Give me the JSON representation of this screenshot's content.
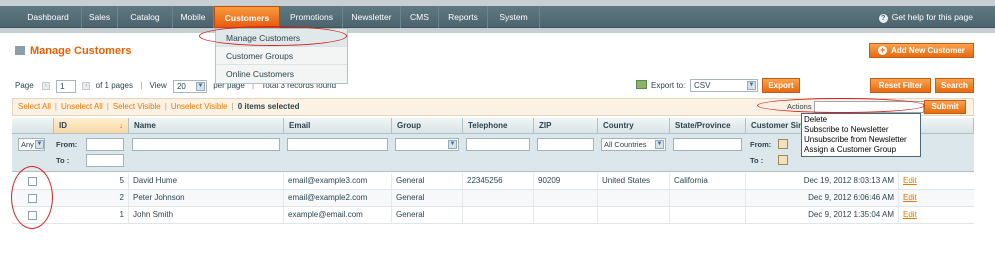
{
  "nav": {
    "items": [
      "Dashboard",
      "Sales",
      "Catalog",
      "Mobile",
      "Customers",
      "Promotions",
      "Newsletter",
      "CMS",
      "Reports",
      "System"
    ],
    "active": "Customers",
    "help": "Get help for this page"
  },
  "dropdown": [
    "Manage Customers",
    "Customer Groups",
    "Online Customers"
  ],
  "page": {
    "title": "Manage Customers",
    "add_button": "Add New Customer"
  },
  "pager": {
    "page_label": "Page",
    "page_value": "1",
    "of_pages": "of 1 pages",
    "view_label": "View",
    "per_page_value": "20",
    "per_page": "per page",
    "records": "Total 3 records found"
  },
  "export": {
    "label": "Export to:",
    "format": "CSV",
    "button": "Export"
  },
  "grid_buttons": {
    "reset": "Reset Filter",
    "search": "Search"
  },
  "massaction": {
    "links": [
      "Select All",
      "Unselect All",
      "Select Visible",
      "Unselect Visible"
    ],
    "selected": "0 items selected",
    "actions_label": "Actions",
    "submit": "Submit",
    "options": [
      "Delete",
      "Subscribe to Newsletter",
      "Unsubscribe from Newsletter",
      "Assign a Customer Group"
    ]
  },
  "columns": [
    "ID",
    "Name",
    "Email",
    "Group",
    "Telephone",
    "ZIP",
    "Country",
    "State/Province",
    "Customer Sin",
    "ion"
  ],
  "filters": {
    "any": "Any",
    "from": "From:",
    "to": "To :",
    "country": "All Countries"
  },
  "rows": [
    {
      "id": "5",
      "name": "David Hume",
      "email": "email@example3.com",
      "group": "General",
      "telephone": "22345256",
      "zip": "90209",
      "country": "United States",
      "state": "California",
      "since": "Dec 19, 2012 8:03:13 AM",
      "action": "Edit"
    },
    {
      "id": "2",
      "name": "Peter Johnson",
      "email": "email@example2.com",
      "group": "General",
      "telephone": "",
      "zip": "",
      "country": "",
      "state": "",
      "since": "Dec 9, 2012 6:06:46 AM",
      "action": "Edit"
    },
    {
      "id": "1",
      "name": "John Smith",
      "email": "example@email.com",
      "group": "General",
      "telephone": "",
      "zip": "",
      "country": "",
      "state": "",
      "since": "Dec 9, 2012 1:35:04 AM",
      "action": "Edit"
    }
  ]
}
